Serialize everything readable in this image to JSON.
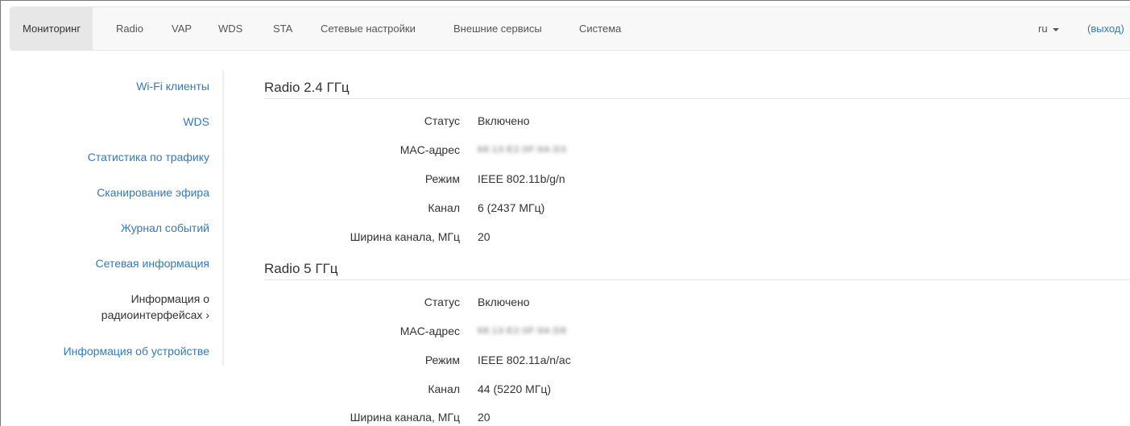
{
  "navbar": {
    "items": [
      {
        "label": "Мониторинг",
        "active": true
      },
      {
        "label": "Radio"
      },
      {
        "label": "VAP"
      },
      {
        "label": "WDS"
      },
      {
        "label": "STA"
      },
      {
        "label": "Сетевые настройки"
      },
      {
        "label": "Внешние сервисы"
      },
      {
        "label": "Система"
      }
    ],
    "language": "ru",
    "logout": "(выход)"
  },
  "sidebar": {
    "items": [
      {
        "label": "Wi-Fi клиенты"
      },
      {
        "label": "WDS"
      },
      {
        "label": "Статистика по трафику"
      },
      {
        "label": "Сканирование эфира"
      },
      {
        "label": "Журнал событий"
      },
      {
        "label": "Сетевая информация"
      },
      {
        "label_line1": "Информация о",
        "label_line2": "радиоинтерфейсах ›",
        "active": true
      },
      {
        "label": "Информация об устройстве"
      }
    ]
  },
  "radios": [
    {
      "title": "Radio 2.4 ГГц",
      "rows": [
        {
          "label": "Статус",
          "value": "Включено"
        },
        {
          "label": "MAC-адрес",
          "value": "68:13:E2:0F:9A:D3"
        },
        {
          "label": "Режим",
          "value": "IEEE 802.11b/g/n"
        },
        {
          "label": "Канал",
          "value": "6 (2437 МГц)"
        },
        {
          "label": "Ширина канала, МГц",
          "value": "20"
        }
      ]
    },
    {
      "title": "Radio 5 ГГц",
      "rows": [
        {
          "label": "Статус",
          "value": "Включено"
        },
        {
          "label": "MAC-адрес",
          "value": "68:13:E2:0F:9A:D8"
        },
        {
          "label": "Режим",
          "value": "IEEE 802.11a/n/ac"
        },
        {
          "label": "Канал",
          "value": "44 (5220 МГц)"
        },
        {
          "label": "Ширина канала, МГц",
          "value": "20"
        }
      ]
    }
  ]
}
